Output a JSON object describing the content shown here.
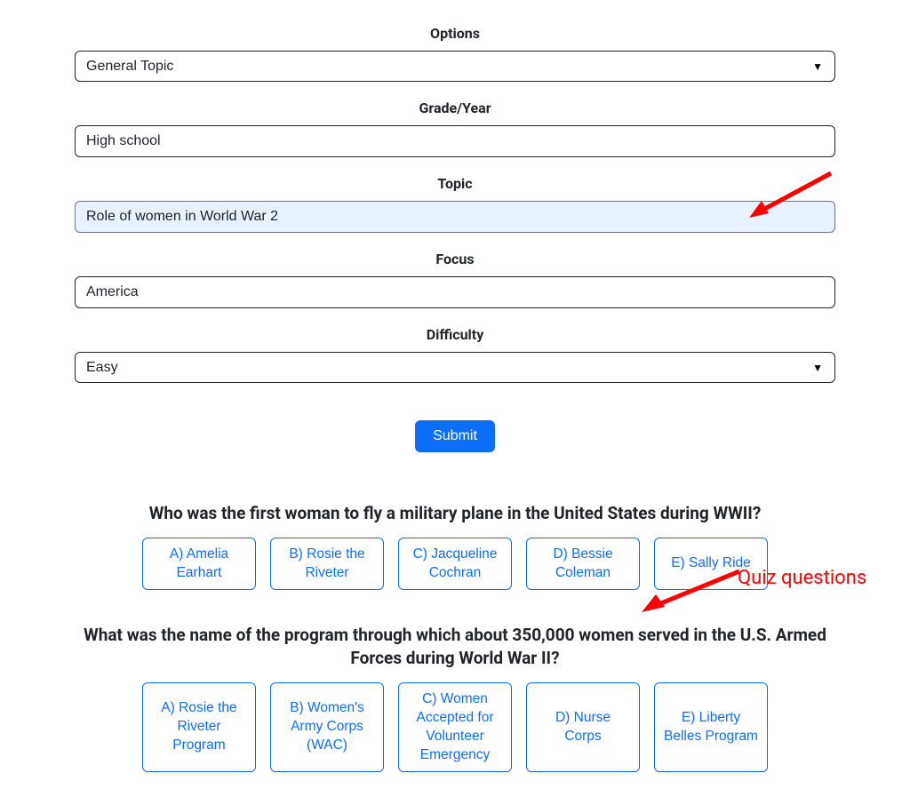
{
  "form": {
    "options": {
      "label": "Options",
      "value": "General Topic"
    },
    "grade": {
      "label": "Grade/Year",
      "value": "High school"
    },
    "topic": {
      "label": "Topic",
      "value": "Role of women in World War 2"
    },
    "focus": {
      "label": "Focus",
      "value": "America"
    },
    "difficulty": {
      "label": "Difficulty",
      "value": "Easy"
    },
    "submit": "Submit"
  },
  "questions": [
    {
      "text": "Who was the first woman to fly a military plane in the United States during WWII?",
      "answers": [
        "A) Amelia Earhart",
        "B) Rosie the Riveter",
        "C) Jacqueline Cochran",
        "D) Bessie Coleman",
        "E) Sally Ride"
      ]
    },
    {
      "text": "What was the name of the program through which about 350,000 women served in the U.S. Armed Forces during World War II?",
      "answers": [
        "A) Rosie the Riveter Program",
        "B) Women's Army Corps (WAC)",
        "C) Women Accepted for Volunteer Emergency",
        "D) Nurse Corps",
        "E) Liberty Belles Program"
      ]
    }
  ],
  "annotation": {
    "label": "Quiz questions"
  }
}
